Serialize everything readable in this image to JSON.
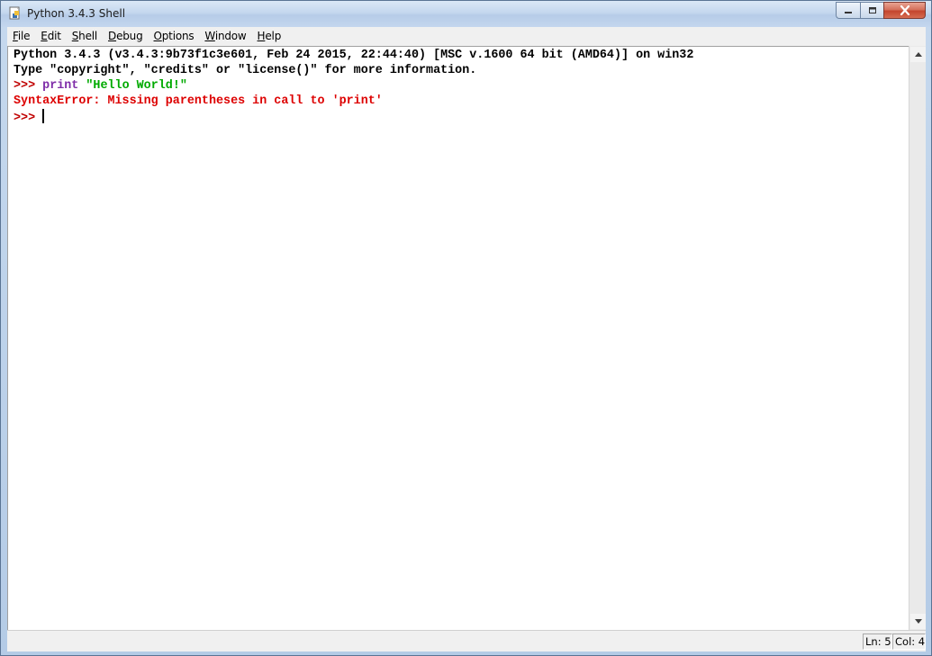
{
  "window": {
    "title": "Python 3.4.3 Shell",
    "controls": {
      "minimize_icon": "minimize-icon",
      "maximize_icon": "maximize-icon",
      "close_icon": "close-icon"
    }
  },
  "menu": [
    {
      "label": "File",
      "mnemonic": "F",
      "rest": "ile"
    },
    {
      "label": "Edit",
      "mnemonic": "E",
      "rest": "dit"
    },
    {
      "label": "Shell",
      "mnemonic": "S",
      "rest": "hell"
    },
    {
      "label": "Debug",
      "mnemonic": "D",
      "rest": "ebug"
    },
    {
      "label": "Options",
      "mnemonic": "O",
      "rest": "ptions"
    },
    {
      "label": "Window",
      "mnemonic": "W",
      "rest": "indow"
    },
    {
      "label": "Help",
      "mnemonic": "H",
      "rest": "elp"
    }
  ],
  "shell": {
    "banner_line1": "Python 3.4.3 (v3.4.3:9b73f1c3e601, Feb 24 2015, 22:44:40) [MSC v.1600 64 bit (AMD64)] on win32",
    "banner_line2": "Type \"copyright\", \"credits\" or \"license()\" for more information.",
    "prompt": ">>> ",
    "input_keyword": "print",
    "input_string": "\"Hello World!\"",
    "error_line": "SyntaxError: Missing parentheses in call to 'print'",
    "current_prompt": ">>> "
  },
  "status": {
    "line": "Ln: 5",
    "column": "Col: 4"
  },
  "colors": {
    "prompt": "#c00000",
    "keyword": "#7e2ca8",
    "string": "#00aa00",
    "error": "#dd0000"
  }
}
